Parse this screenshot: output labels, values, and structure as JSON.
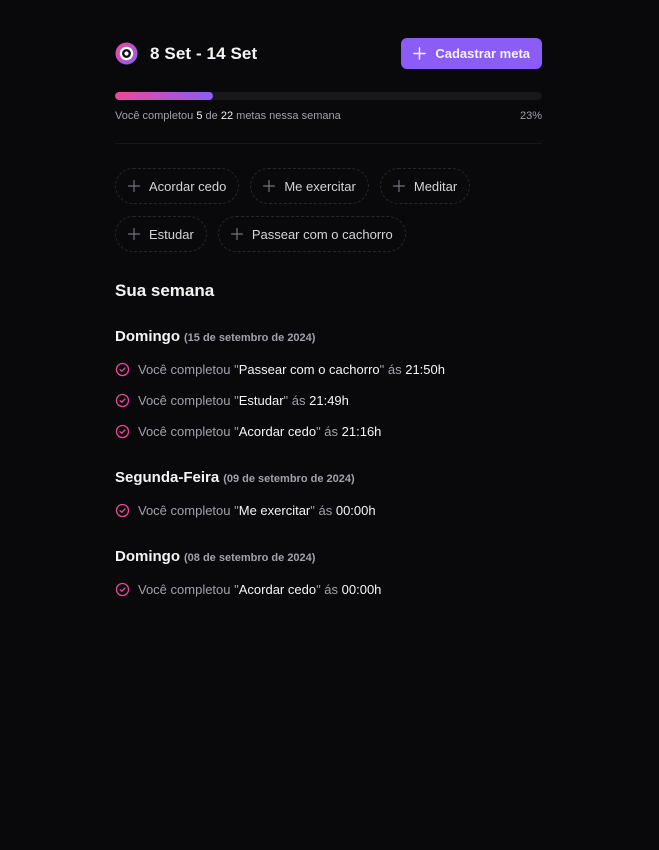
{
  "header": {
    "week_range": "8 Set - 14 Set",
    "logo_icon": "in-orbit-logo-icon",
    "new_goal_label": "Cadastrar meta",
    "new_goal_icon": "plus-icon"
  },
  "progress": {
    "completed": "5",
    "total": "22",
    "prefix": "Você completou",
    "of_word": "de",
    "suffix": "metas nessa semana",
    "percent_label": "23%",
    "percent_value": 23
  },
  "pending_goals": [
    {
      "label": "Acordar cedo"
    },
    {
      "label": "Me exercitar"
    },
    {
      "label": "Meditar"
    },
    {
      "label": "Estudar"
    },
    {
      "label": "Passear com o cachorro"
    }
  ],
  "summary": {
    "title": "Sua semana",
    "days": [
      {
        "weekday": "Domingo",
        "date": "(15 de setembro de 2024)",
        "entries": [
          {
            "prefix": "Você completou \"",
            "goal": "Passear com o cachorro",
            "mid": "\" ás ",
            "time": "21:50h"
          },
          {
            "prefix": "Você completou \"",
            "goal": "Estudar",
            "mid": "\" ás ",
            "time": "21:49h"
          },
          {
            "prefix": "Você completou \"",
            "goal": "Acordar cedo",
            "mid": "\" ás ",
            "time": "21:16h"
          }
        ]
      },
      {
        "weekday": "Segunda-Feira",
        "date": "(09 de setembro de 2024)",
        "entries": [
          {
            "prefix": "Você completou \"",
            "goal": "Me exercitar",
            "mid": "\" ás ",
            "time": "00:00h"
          }
        ]
      },
      {
        "weekday": "Domingo",
        "date": "(08 de setembro de 2024)",
        "entries": [
          {
            "prefix": "Você completou \"",
            "goal": "Acordar cedo",
            "mid": "\" ás ",
            "time": "00:00h"
          }
        ]
      }
    ]
  },
  "colors": {
    "background": "#09090b",
    "accent_violet": "#8b5cf6",
    "accent_pink": "#ec4899",
    "check": "#ec4899"
  },
  "icons": {
    "chip_icon": "plus-icon",
    "entry_icon": "circle-check-icon"
  }
}
